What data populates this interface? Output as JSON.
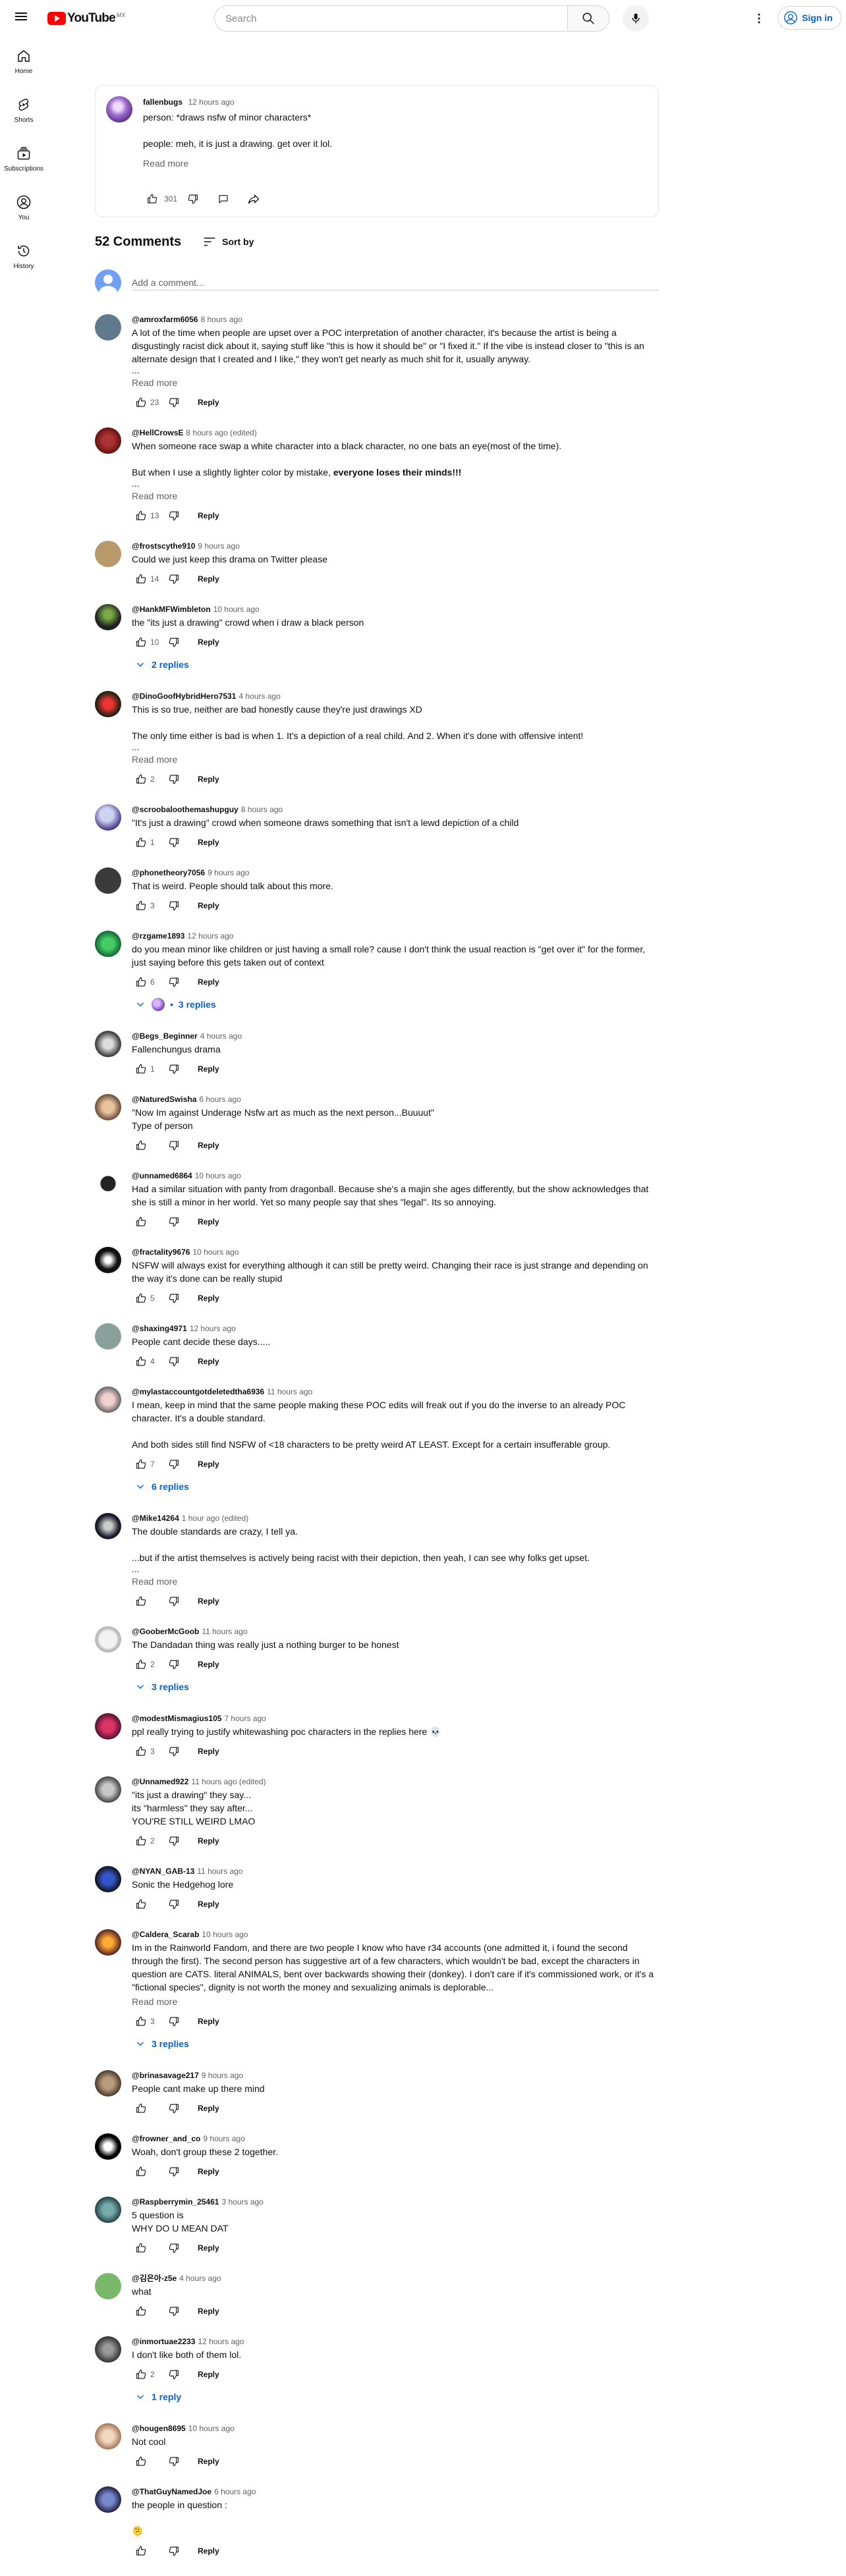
{
  "app": {
    "logo_text": "YouTube",
    "logo_region": "MX",
    "brand_color": "#ff0000",
    "link_color": "#065fd4"
  },
  "search": {
    "placeholder": "Search"
  },
  "header": {
    "sign_in": "Sign in"
  },
  "sidenav": [
    {
      "label": "Home",
      "icon": "home-icon"
    },
    {
      "label": "Shorts",
      "icon": "shorts-icon"
    },
    {
      "label": "Subscriptions",
      "icon": "subscriptions-icon"
    },
    {
      "label": "You",
      "icon": "you-icon"
    },
    {
      "label": "History",
      "icon": "history-icon"
    }
  ],
  "post": {
    "author": "fallenbugs",
    "time": "12 hours ago",
    "text": "person: *draws nsfw of minor characters*\n\npeople: meh, it is just a drawing. get over it lol.",
    "read_more": "Read more",
    "likes": "301"
  },
  "comments_header": {
    "count": "52 Comments",
    "sort": "Sort by"
  },
  "add_comment": {
    "placeholder": "Add a comment..."
  },
  "reply_label": "Reply",
  "comments": [
    {
      "handle": "@amroxfarm6056",
      "time": "8 hours ago",
      "text": "A lot of the time when people are upset over a POC interpretation of another character, it's because the artist is being a disgustingly racist dick about it, saying stuff like \"this is how it should be\" or \"I fixed it.\" If the vibe is instead closer to \"this is an alternate design that I created and I like,\" they won't get nearly as much shit for it, usually anyway.",
      "bold": "",
      "text_after": "",
      "dots": "...",
      "more": "Read more",
      "likes": "23",
      "replies": ""
    },
    {
      "handle": "@HellCrowsE",
      "time": "8 hours ago (edited)",
      "text": "When someone race swap a white character into a black character, no one bats an eye(most of the time).\n\nBut when I use a slightly lighter color by mistake, ",
      "bold": "everyone loses their minds!!!",
      "text_after": "",
      "dots": "...",
      "more": "Read more",
      "likes": "13",
      "replies": ""
    },
    {
      "handle": "@frostscythe910",
      "time": "9 hours ago",
      "text": "Could we just keep this drama on Twitter please",
      "bold": "",
      "text_after": "",
      "dots": "",
      "more": "",
      "likes": "14",
      "replies": ""
    },
    {
      "handle": "@HankMFWimbleton",
      "time": "10 hours ago",
      "text": "the \"its just a drawing\" crowd when i draw a black person",
      "bold": "",
      "text_after": "",
      "dots": "",
      "more": "",
      "likes": "10",
      "replies": "2 replies"
    },
    {
      "handle": "@DinoGoofHybridHero7531",
      "time": "4 hours ago",
      "text": "This is so true, neither are bad honestly cause they're just drawings XD\n\nThe only time either is bad is when 1. It's a depiction of a real child. And 2. When it's done with offensive intent!",
      "bold": "",
      "text_after": "",
      "dots": "...",
      "more": "Read more",
      "likes": "2",
      "replies": ""
    },
    {
      "handle": "@scroobaloothemashupguy",
      "time": "8 hours ago",
      "text": "\"It's just a drawing\" crowd when someone draws something that isn't a lewd depiction of a child",
      "bold": "",
      "text_after": "",
      "dots": "",
      "more": "",
      "likes": "1",
      "replies": ""
    },
    {
      "handle": "@phonetheory7056",
      "time": "9 hours ago",
      "text": "That is weird. People should talk about this more.",
      "bold": "",
      "text_after": "",
      "dots": "",
      "more": "",
      "likes": "3",
      "replies": ""
    },
    {
      "handle": "@rzgame1893",
      "time": "12 hours ago",
      "text": "do you mean minor like children or just having a small role? cause I don't think the usual reaction is \"get over it\" for the former, just saying before this gets taken out of context",
      "bold": "",
      "text_after": "",
      "dots": "",
      "more": "",
      "likes": "6",
      "replies": "3 replies",
      "replies_avatar": true
    },
    {
      "handle": "@Begs_Beginner",
      "time": "4 hours ago",
      "text": "Fallenchungus drama",
      "bold": "",
      "text_after": "",
      "dots": "",
      "more": "",
      "likes": "1",
      "replies": ""
    },
    {
      "handle": "@NaturedSwisha",
      "time": "6 hours ago",
      "text": "\"Now Im against Underage Nsfw art as much as the next person...Buuuut\"\nType of person",
      "bold": "",
      "text_after": "",
      "dots": "",
      "more": "",
      "likes": "",
      "replies": ""
    },
    {
      "handle": "@unnamed6864",
      "time": "10 hours ago",
      "text": "Had a similar situation with panty from dragonball. Because she's a majin she ages differently, but the show acknowledges that she is still a minor in her world. Yet so many people say that shes \"legal\". Its so annoying.",
      "bold": "",
      "text_after": "",
      "dots": "",
      "more": "",
      "likes": "",
      "replies": ""
    },
    {
      "handle": "@fractality9676",
      "time": "10 hours ago",
      "text": "NSFW will always exist for everything although it can still be pretty weird. Changing their race is just strange and depending on the way it's done can be really stupid",
      "bold": "",
      "text_after": "",
      "dots": "",
      "more": "",
      "likes": "5",
      "replies": ""
    },
    {
      "handle": "@shaxing4971",
      "time": "12 hours ago",
      "text": "People cant decide these days.....",
      "bold": "",
      "text_after": "",
      "dots": "",
      "more": "",
      "likes": "4",
      "replies": ""
    },
    {
      "handle": "@mylastaccountgotdeletedtha6936",
      "time": "11 hours ago",
      "text": "I mean, keep in mind that the same people making these POC edits will freak out if you do the inverse to an already POC character. It's a double standard.\n\nAnd both sides still find NSFW of <18 characters to be pretty weird AT LEAST. Except for a certain insufferable group.",
      "bold": "",
      "text_after": "",
      "dots": "",
      "more": "",
      "likes": "7",
      "replies": "6 replies"
    },
    {
      "handle": "@Mike14264",
      "time": "1 hour ago (edited)",
      "text": "The double standards are crazy, I tell ya.\n\n...but if the artist themselves is actively being racist with their depiction, then yeah, I can see why folks get upset.",
      "bold": "",
      "text_after": "",
      "dots": "...",
      "more": "Read more",
      "likes": "",
      "replies": ""
    },
    {
      "handle": "@GooberMcGoob",
      "time": "11 hours ago",
      "text": "The Dandadan thing was really just a nothing burger to be honest",
      "bold": "",
      "text_after": "",
      "dots": "",
      "more": "",
      "likes": "2",
      "replies": "3 replies"
    },
    {
      "handle": "@modestMismagius105",
      "time": "7 hours ago",
      "text": "ppl really trying to justify whitewashing poc characters in the replies here 💀",
      "bold": "",
      "text_after": "",
      "dots": "",
      "more": "",
      "likes": "3",
      "replies": ""
    },
    {
      "handle": "@Unnamed922",
      "time": "11 hours ago (edited)",
      "text": "\"its just a drawing\" they say...\nits \"harmless\" they say after...\nYOU'RE STILL WEIRD LMAO",
      "bold": "",
      "text_after": "",
      "dots": "",
      "more": "",
      "likes": "2",
      "replies": ""
    },
    {
      "handle": "@NYAN_GAB-13",
      "time": "11 hours ago",
      "text": "Sonic the Hedgehog lore",
      "bold": "",
      "text_after": "",
      "dots": "",
      "more": "",
      "likes": "",
      "replies": ""
    },
    {
      "handle": "@Caldera_Scarab",
      "time": "10 hours ago",
      "text": "Im in the Rainworld Fandom, and there are two people I know who have r34 accounts (one admitted it, i found the second through the first). The second person has suggestive art of a few characters, which wouldn't be bad, except the characters in question are CATS. literal ANIMALS, bent over backwards showing their (donkey). I don't care if it's commissioned work, or it's a \"fictional species\", dignity is not worth the money and sexualizing animals is deplorable...",
      "bold": "",
      "text_after": "",
      "dots": "",
      "more": "Read more",
      "likes": "3",
      "replies": "3 replies"
    },
    {
      "handle": "@brinasavage217",
      "time": "9 hours ago",
      "text": "People cant make up there mind",
      "bold": "",
      "text_after": "",
      "dots": "",
      "more": "",
      "likes": "",
      "replies": ""
    },
    {
      "handle": "@frowner_and_co",
      "time": "9 hours ago",
      "text": "Woah, don't group these 2 together.",
      "bold": "",
      "text_after": "",
      "dots": "",
      "more": "",
      "likes": "",
      "replies": ""
    },
    {
      "handle": "@Raspberrymin_25461",
      "time": "3 hours ago",
      "text": "5 question is\nWHY DO U MEAN DAT",
      "bold": "",
      "text_after": "",
      "dots": "",
      "more": "",
      "likes": "",
      "replies": ""
    },
    {
      "handle": "@김은아-z5e",
      "time": "4 hours ago",
      "text": "what",
      "bold": "",
      "text_after": "",
      "dots": "",
      "more": "",
      "likes": "",
      "replies": ""
    },
    {
      "handle": "@inmortuae2233",
      "time": "12 hours ago",
      "text": "I don't like both of them lol.",
      "bold": "",
      "text_after": "",
      "dots": "",
      "more": "",
      "likes": "2",
      "replies": "1 reply"
    },
    {
      "handle": "@hougen8695",
      "time": "10 hours ago",
      "text": "Not cool",
      "bold": "",
      "text_after": "",
      "dots": "",
      "more": "",
      "likes": "",
      "replies": ""
    },
    {
      "handle": "@ThatGuyNamedJoe",
      "time": "6 hours ago",
      "text": "the people in question :\n\n🫠",
      "bold": "",
      "text_after": "",
      "dots": "",
      "more": "",
      "likes": "",
      "replies": ""
    }
  ]
}
